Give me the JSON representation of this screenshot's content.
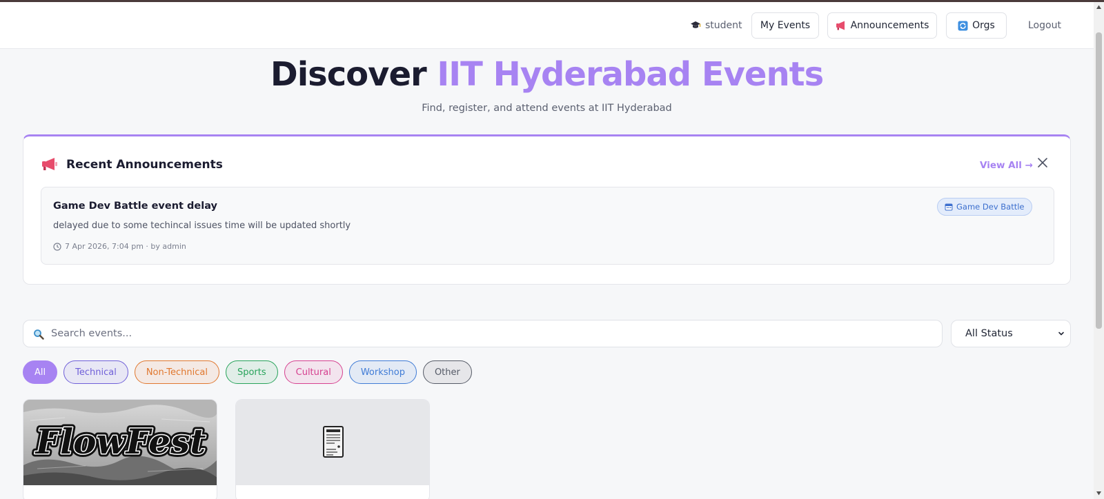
{
  "nav": {
    "user_label": "student",
    "my_events_label": "My Events",
    "announcements_label": "Announcements",
    "orgs_label": "Orgs",
    "logout_label": "Logout"
  },
  "hero": {
    "title_part1": "Discover",
    "title_part2": "IIT Hyderabad Events",
    "subtitle": "Find, register, and attend events at IIT Hyderabad"
  },
  "announcements": {
    "heading": "Recent Announcements",
    "view_all_label": "View All →",
    "items": [
      {
        "title": "Game Dev Battle event delay",
        "body": "delayed due to some techincal issues time will be updated shortly",
        "meta": "7 Apr 2026, 7:04 pm · by admin",
        "tag": "Game Dev Battle"
      }
    ]
  },
  "search": {
    "placeholder": "Search events..."
  },
  "status_filter": {
    "selected": "All Status"
  },
  "categories": [
    {
      "label": "All",
      "color": "#a783f2"
    },
    {
      "label": "Technical",
      "color": "#6f5fd8"
    },
    {
      "label": "Non-Technical",
      "color": "#e0772e"
    },
    {
      "label": "Sports",
      "color": "#27a35a"
    },
    {
      "label": "Cultural",
      "color": "#d6408f"
    },
    {
      "label": "Workshop",
      "color": "#3f7bd6"
    },
    {
      "label": "Other",
      "color": "#555a66"
    }
  ],
  "events": [
    {
      "image_text": "FlowFest"
    },
    {
      "image_icon": "document-icon"
    }
  ],
  "colors": {
    "accent": "#a783f2",
    "dark_text": "#1b1c30"
  }
}
